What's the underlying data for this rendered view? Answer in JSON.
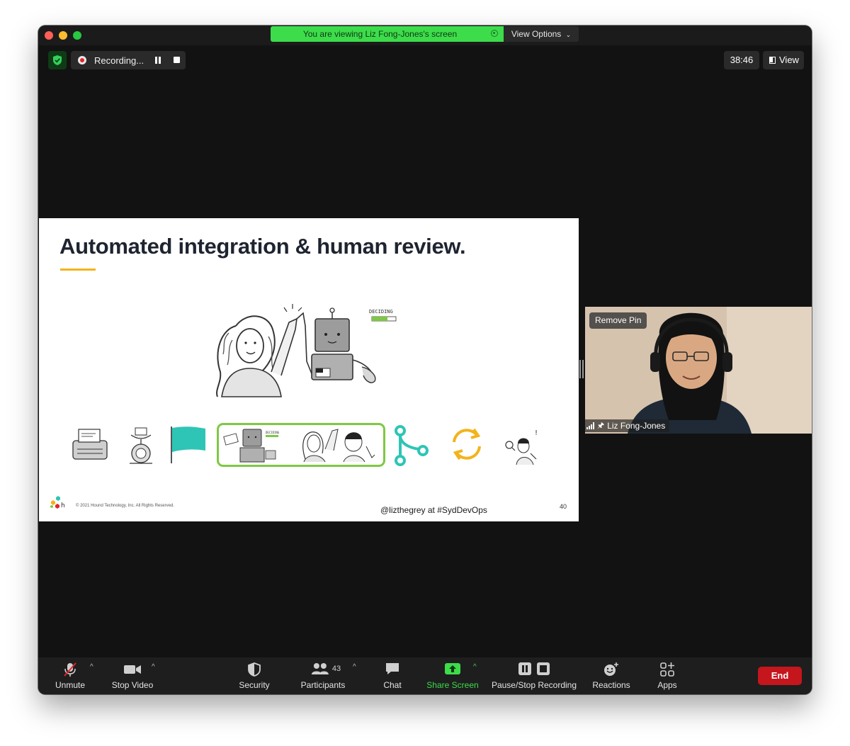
{
  "window": {
    "share_banner": "You are viewing Liz Fong-Jones's screen",
    "view_options": "View Options",
    "recording_label": "Recording...",
    "timer": "38:46",
    "view_label": "View"
  },
  "slide": {
    "title": "Automated integration & human review.",
    "illustration_caption": "DECIDING",
    "filmstrip_caption": "DECIDING",
    "copyright": "© 2021 Hound Technology, Inc. All Rights Reserved.",
    "logo_text": "h",
    "handle": "@lizthegrey at #SydDevOps",
    "page_number": "40"
  },
  "video": {
    "remove_pin": "Remove Pin",
    "participant_name": "Liz Fong-Jones"
  },
  "toolbar": {
    "unmute": "Unmute",
    "stop_video": "Stop Video",
    "security": "Security",
    "participants": "Participants",
    "participants_count": "43",
    "chat": "Chat",
    "share_screen": "Share Screen",
    "pause_stop_recording": "Pause/Stop Recording",
    "reactions": "Reactions",
    "apps": "Apps",
    "end": "End"
  },
  "colors": {
    "share_green": "#3ddc4b",
    "end_red": "#c4161c",
    "accent_teal": "#2ec5b6",
    "accent_yellow": "#f3b31b",
    "filmstrip_highlight": "#7ec843"
  }
}
